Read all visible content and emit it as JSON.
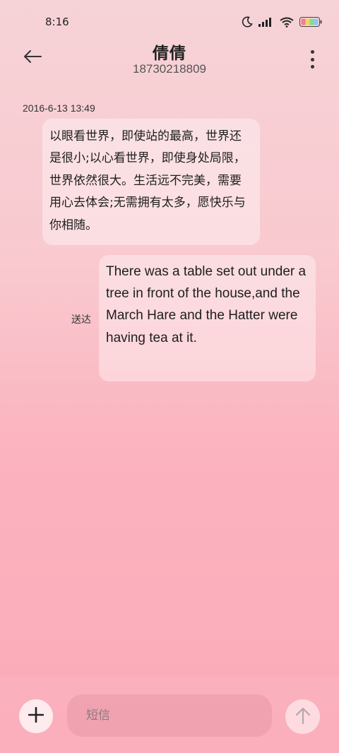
{
  "status_bar": {
    "time": "8:16",
    "icons": [
      "moon-icon",
      "signal-icon",
      "wifi-icon",
      "battery-icon"
    ]
  },
  "header": {
    "back_icon": "arrow-left-icon",
    "title": "倩倩",
    "subtitle": "18730218809",
    "more_icon": "more-vertical-icon"
  },
  "conversation": {
    "timestamp": "2016-6-13 13:49",
    "messages": [
      {
        "direction": "incoming",
        "text": "以眼看世界，即使站的最高，世界还是很小;以心看世界，即使身处局限，世界依然很大。生活远不完美，需要用心去体会;无需拥有太多，愿快乐与你相随。"
      },
      {
        "direction": "outgoing",
        "text": "There was a table set out under a tree in front of the house,and the March Hare and the Hatter were having tea at it.",
        "status": "送达"
      }
    ]
  },
  "composer": {
    "add_icon": "plus-icon",
    "placeholder": "短信",
    "value": "",
    "send_icon": "arrow-up-icon"
  },
  "colors": {
    "background_top": "#f6d3d7",
    "background_bottom": "#fbaab8",
    "bubble": "#ffffff"
  }
}
